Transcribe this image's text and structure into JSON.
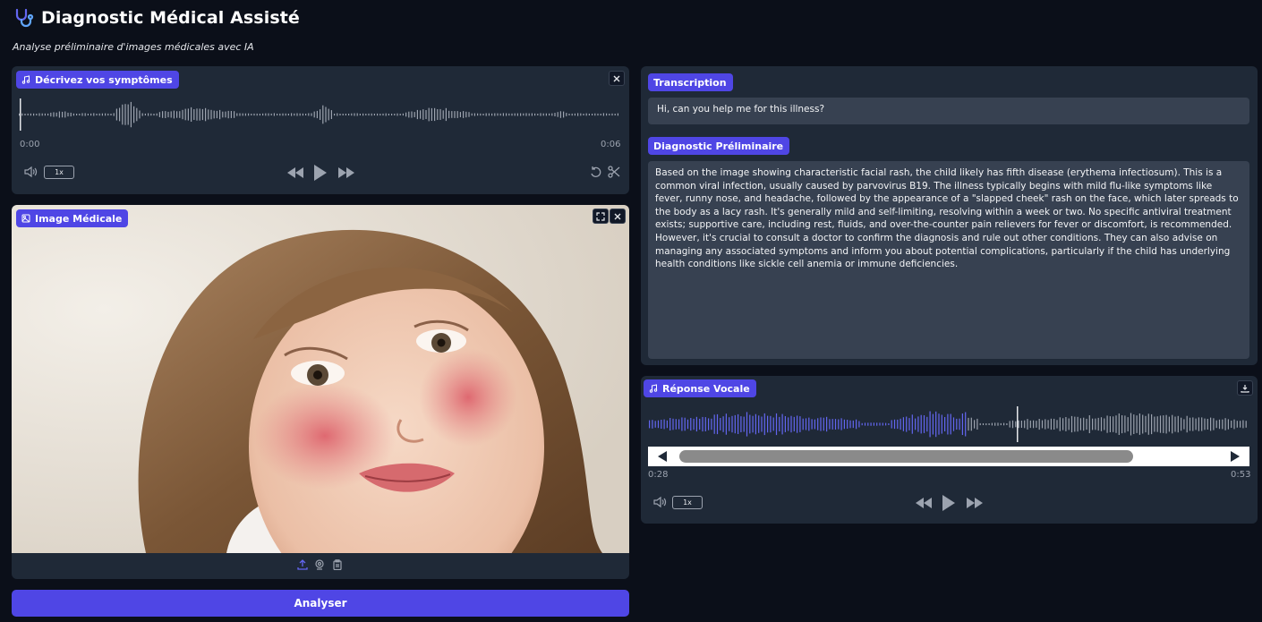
{
  "app": {
    "title": "Diagnostic Médical Assisté",
    "subtitle": "Analyse préliminaire d'images médicales avec IA"
  },
  "symptoms_audio": {
    "label": "Décrivez vos symptômes",
    "current_time": "0:00",
    "duration": "0:06",
    "speed": "1x"
  },
  "image_panel": {
    "label": "Image Médicale"
  },
  "transcription": {
    "label": "Transcription",
    "text": "Hi, can you help me for this illness?"
  },
  "diagnostic": {
    "label": "Diagnostic Préliminaire",
    "text": "Based on the image showing characteristic facial rash, the child likely has fifth disease (erythema infectiosum).  This is a common viral infection, usually caused by parvovirus B19.  The illness typically begins with mild flu-like symptoms like fever, runny nose, and headache, followed by the appearance of a \"slapped cheek\" rash on the face, which later spreads to the body as a lacy rash.  It's generally mild and self-limiting, resolving within a week or two.  No specific antiviral treatment exists; supportive care, including rest, fluids, and over-the-counter pain relievers for fever or discomfort, is recommended.  However, it's crucial to consult a doctor to confirm the diagnosis and rule out other conditions.  They can also advise on managing any associated symptoms and inform you about potential complications, particularly if the child has underlying health conditions like sickle cell anemia or immune deficiencies."
  },
  "voice_response": {
    "label": "Réponse Vocale",
    "current_time": "0:28",
    "duration": "0:53",
    "speed": "1x",
    "progress": 0.53
  },
  "actions": {
    "analyze_label": "Analyser"
  },
  "colors": {
    "accent": "#4f46e5",
    "background": "#0b0f19",
    "panel": "#1f2937",
    "textbox": "#374151",
    "waveform_played": "#6366f1",
    "waveform_unplayed": "#9ca3af"
  },
  "icons": [
    "stethoscope-icon",
    "music-icon",
    "close-icon",
    "volume-icon",
    "rewind-icon",
    "play-icon",
    "fast-forward-icon",
    "undo-icon",
    "scissors-icon",
    "image-icon",
    "fullscreen-icon",
    "upload-icon",
    "webcam-icon",
    "clipboard-icon",
    "download-icon"
  ]
}
